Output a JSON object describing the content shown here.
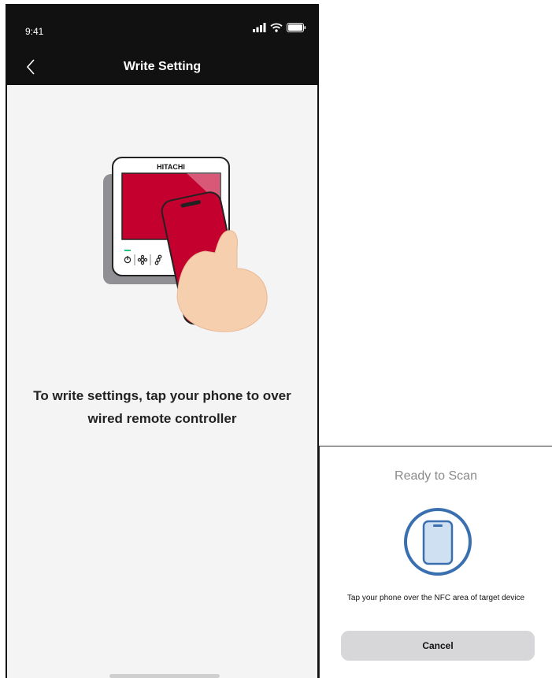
{
  "status_bar": {
    "time": "9:41"
  },
  "header": {
    "title": "Write Setting"
  },
  "illustration": {
    "brand": "HITACHI"
  },
  "main": {
    "instruction": "To write settings, tap your phone to over wired remote controller"
  },
  "nfc_sheet": {
    "title": "Ready to Scan",
    "message": "Tap your phone over the NFC area of target device",
    "cancel_label": "Cancel"
  },
  "colors": {
    "header_bg": "#111111",
    "screen_bg": "#f4f4f4",
    "accent_red": "#c4002f",
    "scan_blue": "#3a6fb0"
  }
}
